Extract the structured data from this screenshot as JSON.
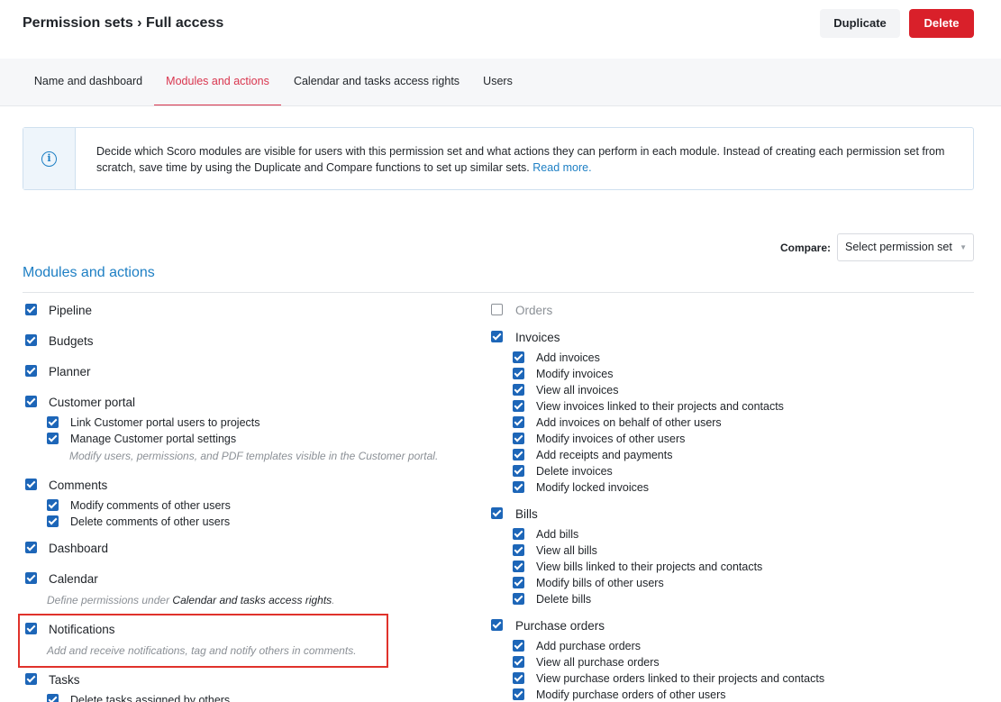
{
  "header": {
    "title": "Permission sets › Full access",
    "duplicate_label": "Duplicate",
    "delete_label": "Delete"
  },
  "tabs": [
    {
      "label": "Name and dashboard",
      "active": false
    },
    {
      "label": "Modules and actions",
      "active": true
    },
    {
      "label": "Calendar and tasks access rights",
      "active": false
    },
    {
      "label": "Users",
      "active": false
    }
  ],
  "info": {
    "icon": "info-circle-icon",
    "text": "Decide which Scoro modules are visible for users with this permission set and what actions they can perform in each module. Instead of creating each permission set from scratch, save time by using the Duplicate and Compare functions to set up similar sets.",
    "link": "Read more."
  },
  "compare": {
    "label": "Compare:",
    "placeholder": "Select permission set"
  },
  "section_title": "Modules and actions",
  "left": {
    "pipeline": "Pipeline",
    "budgets": "Budgets",
    "planner": "Planner",
    "customer_portal": "Customer portal",
    "cp_link": "Link Customer portal users to projects",
    "cp_manage": "Manage Customer portal settings",
    "cp_hint": "Modify users, permissions, and PDF templates visible in the Customer portal.",
    "comments": "Comments",
    "comments_modify": "Modify comments of other users",
    "comments_delete": "Delete comments of other users",
    "dashboard": "Dashboard",
    "calendar": "Calendar",
    "calendar_hint_prefix": "Define permissions under ",
    "calendar_hint_link": "Calendar and tasks access rights",
    "calendar_hint_suffix": ".",
    "notifications": "Notifications",
    "notifications_hint": "Add and receive notifications, tag and notify others in comments.",
    "tasks": "Tasks",
    "tasks_delete": "Delete tasks assigned by others"
  },
  "right": {
    "orders": "Orders",
    "invoices": "Invoices",
    "inv_items": [
      "Add invoices",
      "Modify invoices",
      "View all invoices",
      "View invoices linked to their projects and contacts",
      "Add invoices on behalf of other users",
      "Modify invoices of other users",
      "Add receipts and payments",
      "Delete invoices",
      "Modify locked invoices"
    ],
    "bills": "Bills",
    "bill_items": [
      "Add bills",
      "View all bills",
      "View bills linked to their projects and contacts",
      "Modify bills of other users",
      "Delete bills"
    ],
    "purchase_orders": "Purchase orders",
    "po_items": [
      "Add purchase orders",
      "View all purchase orders",
      "View purchase orders linked to their projects and contacts",
      "Modify purchase orders of other users"
    ]
  },
  "colors": {
    "accent": "#1d7fc4",
    "checkbox": "#1d66b8",
    "active_tab": "#d9354e",
    "delete": "#d9202a",
    "highlight": "#e0322b"
  }
}
